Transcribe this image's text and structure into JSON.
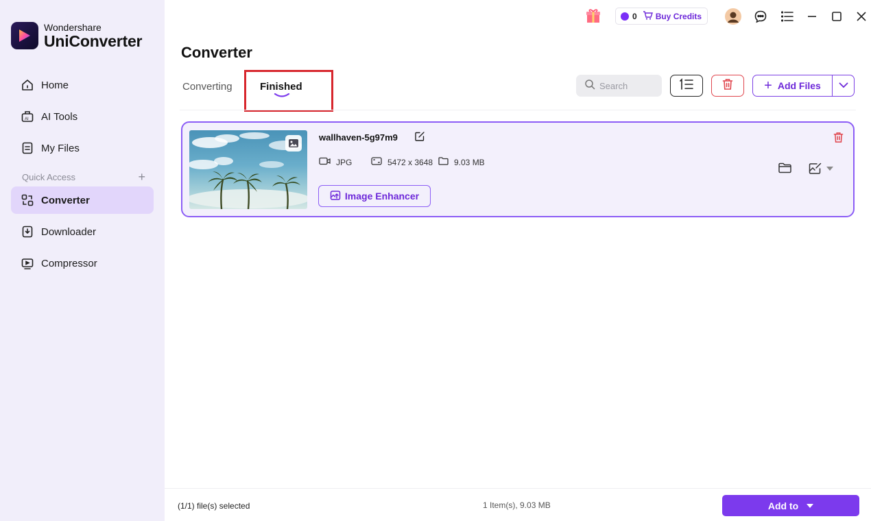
{
  "brand": {
    "company": "Wondershare",
    "product": "UniConverter"
  },
  "sidebar": {
    "items": [
      {
        "label": "Home",
        "icon": "home-icon"
      },
      {
        "label": "AI Tools",
        "icon": "ai-tools-icon"
      },
      {
        "label": "My Files",
        "icon": "my-files-icon"
      },
      {
        "label": "Converter",
        "icon": "converter-icon",
        "active": true
      },
      {
        "label": "Downloader",
        "icon": "downloader-icon"
      },
      {
        "label": "Compressor",
        "icon": "compressor-icon"
      }
    ],
    "quick_access_label": "Quick Access",
    "quick_access_add": "+"
  },
  "titlebar": {
    "credits_count": "0",
    "buy_credits_label": "Buy Credits"
  },
  "page": {
    "title": "Converter"
  },
  "tabs": [
    {
      "label": "Converting",
      "active": false
    },
    {
      "label": "Finished",
      "active": true
    }
  ],
  "toolbar": {
    "search_placeholder": "Search",
    "add_files_label": "Add Files"
  },
  "file": {
    "name": "wallhaven-5g97m9",
    "format": "JPG",
    "resolution": "5472 x 3648",
    "size": "9.03 MB",
    "enhancer_label": "Image Enhancer"
  },
  "footer": {
    "selection_text": "(1/1) file(s) selected",
    "summary_text": "1 Item(s), 9.03 MB",
    "add_to_label": "Add to"
  },
  "colors": {
    "accent": "#7c3aed",
    "sidebar_bg": "#f1eefa",
    "active_nav_bg": "#e2d6fb",
    "highlight_red": "#d7262d",
    "danger": "#e0454d"
  }
}
